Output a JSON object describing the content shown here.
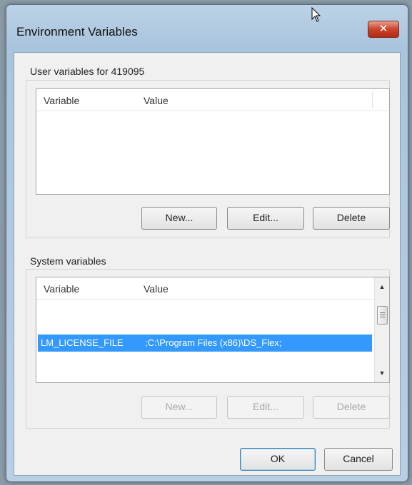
{
  "window": {
    "title": "Environment Variables",
    "close_glyph": "✕"
  },
  "user_vars": {
    "label": "User variables for 419095",
    "columns": [
      "Variable",
      "Value"
    ],
    "rows": [],
    "buttons": {
      "new": "New...",
      "edit": "Edit...",
      "delete": "Delete"
    }
  },
  "system_vars": {
    "label": "System variables",
    "columns": [
      "Variable",
      "Value"
    ],
    "selected_row": {
      "variable": "LM_LICENSE_FILE",
      "value": ";C:\\Program Files (x86)\\DS_Flex;"
    },
    "buttons": {
      "new": "New...",
      "edit": "Edit...",
      "delete": "Delete"
    }
  },
  "footer": {
    "ok": "OK",
    "cancel": "Cancel"
  },
  "colors": {
    "selection": "#3399ff",
    "close_button": "#c9432c"
  },
  "icons": [
    "close-icon",
    "mouse-cursor-icon",
    "scroll-up-arrow-icon",
    "scroll-down-arrow-icon"
  ]
}
